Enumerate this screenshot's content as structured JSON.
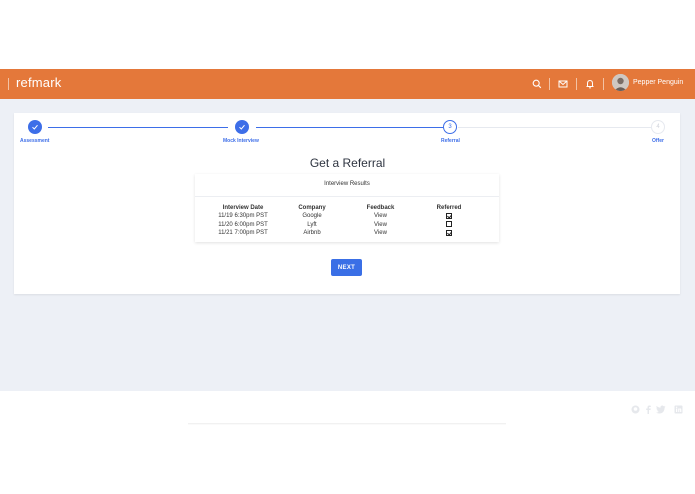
{
  "header": {
    "brand": "refmark",
    "user_name": "Pepper Penguin",
    "icons": [
      "search-icon",
      "mail-icon",
      "bell-icon"
    ]
  },
  "stepper": {
    "steps": [
      {
        "label": "Assessment",
        "state": "done"
      },
      {
        "label": "Mock Interview",
        "state": "done"
      },
      {
        "label": "Referral",
        "state": "current",
        "number": "3"
      },
      {
        "label": "Offer",
        "state": "todo",
        "number": "4"
      }
    ]
  },
  "main": {
    "title": "Get a Referral",
    "panel_title": "Interview Results",
    "columns": [
      "Interview Date",
      "Company",
      "Feedback",
      "Referred"
    ],
    "rows": [
      {
        "date": "11/19 6:30pm PST",
        "company": "Google",
        "feedback": "View",
        "referred": true
      },
      {
        "date": "11/20 6:00pm PST",
        "company": "Lyft",
        "feedback": "View",
        "referred": false
      },
      {
        "date": "11/21 7:00pm PST",
        "company": "Airbnb",
        "feedback": "View",
        "referred": true
      }
    ],
    "next_label": "NEXT"
  },
  "footer": {
    "social_icons": [
      "github-icon",
      "facebook-icon",
      "twitter-icon",
      "linkedin-icon"
    ]
  },
  "colors": {
    "header": "#e4783a",
    "accent": "#3d6ee8",
    "background": "#edf0f6"
  }
}
